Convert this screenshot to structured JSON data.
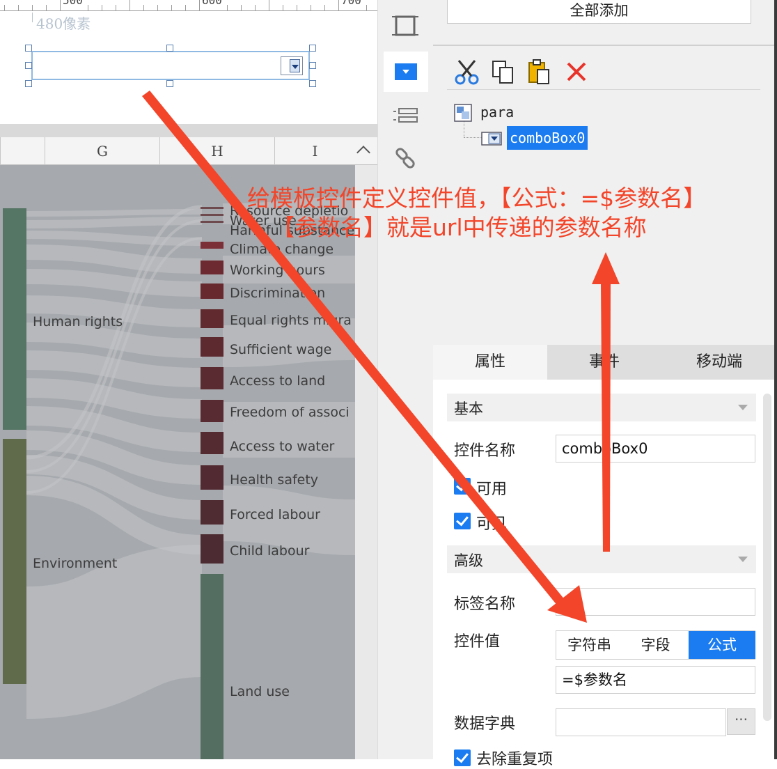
{
  "canvas": {
    "ruler_labels": [
      "500",
      "600",
      "700"
    ],
    "height_note": "480像素"
  },
  "sheet": {
    "columns": [
      "G",
      "H",
      "I"
    ]
  },
  "sankey": {
    "left_nodes": [
      "Human rights",
      "Environment"
    ],
    "right_nodes": [
      "Resource depletio",
      "Water use",
      "Harmful substance",
      "Climate change",
      "Working hours",
      "Discrimination",
      "Equal rights migra",
      "Sufficient wage",
      "Access to land",
      "Freedom of associ",
      "Access to water",
      "Health safety",
      "Forced labour",
      "Child labour",
      "Land use"
    ]
  },
  "panel": {
    "add_all": "全部添加",
    "tree": {
      "root": "para",
      "child": "comboBox0"
    },
    "tabs": [
      "属性",
      "事件",
      "移动端"
    ],
    "section_basic": "基本",
    "section_advanced": "高级",
    "widget_name_label": "控件名称",
    "widget_name_value": "comboBox0",
    "enabled_label": "可用",
    "visible_label": "可见",
    "tag_name_label": "标签名称",
    "tag_name_value": "",
    "widget_value_label": "控件值",
    "value_modes": [
      "字符串",
      "字段",
      "公式"
    ],
    "formula_value": "=$参数名",
    "data_dict_label": "数据字典",
    "data_dict_button": "···",
    "dedupe_label": "去除重复项"
  },
  "annotation": {
    "line1": "给模板控件定义控件值，【公式：=$参数名】",
    "line2": "【参数名】就是url中传递的参数名称",
    "arrow_color": "#f2452a"
  },
  "colors": {
    "accent": "#1a7cf0",
    "delete": "#e8332a"
  }
}
